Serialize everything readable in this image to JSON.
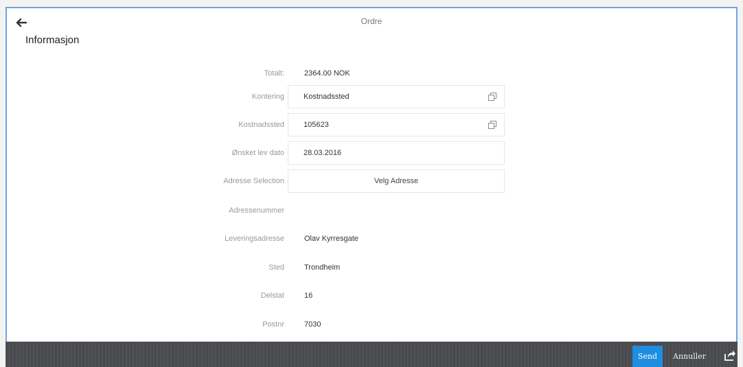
{
  "header": {
    "title": "Ordre",
    "back_icon": "arrow-left-icon"
  },
  "section": {
    "title": "Informasjon"
  },
  "form": {
    "totalt": {
      "label": "Totalt:",
      "value": "2364.00 NOK"
    },
    "kontering": {
      "label": "Kontering",
      "value": "Kostnadssted",
      "icon": "copy-icon"
    },
    "kostnadssted": {
      "label": "Kostnadssted",
      "value": "105623",
      "icon": "copy-icon"
    },
    "onsket_lev_dato": {
      "label": "Ønsket lev dato",
      "value": "28.03.2016"
    },
    "adresse_selection": {
      "label": "Adresse Selection",
      "button": "Velg Adresse"
    },
    "adressenummer": {
      "label": "Adressenummer",
      "value": ""
    },
    "leveringsadresse": {
      "label": "Leveringsadresse",
      "value": "Olav Kyrresgate"
    },
    "sted": {
      "label": "Sted",
      "value": "Trondheim"
    },
    "delstat": {
      "label": "Delstat",
      "value": "16"
    },
    "postnr": {
      "label": "Postnr",
      "value": "7030"
    }
  },
  "footer": {
    "send_label": "Send",
    "cancel_label": "Annuller",
    "share_icon": "share-icon",
    "colors": {
      "bar": "#4a4c50",
      "send": "#1f8ee0"
    }
  }
}
